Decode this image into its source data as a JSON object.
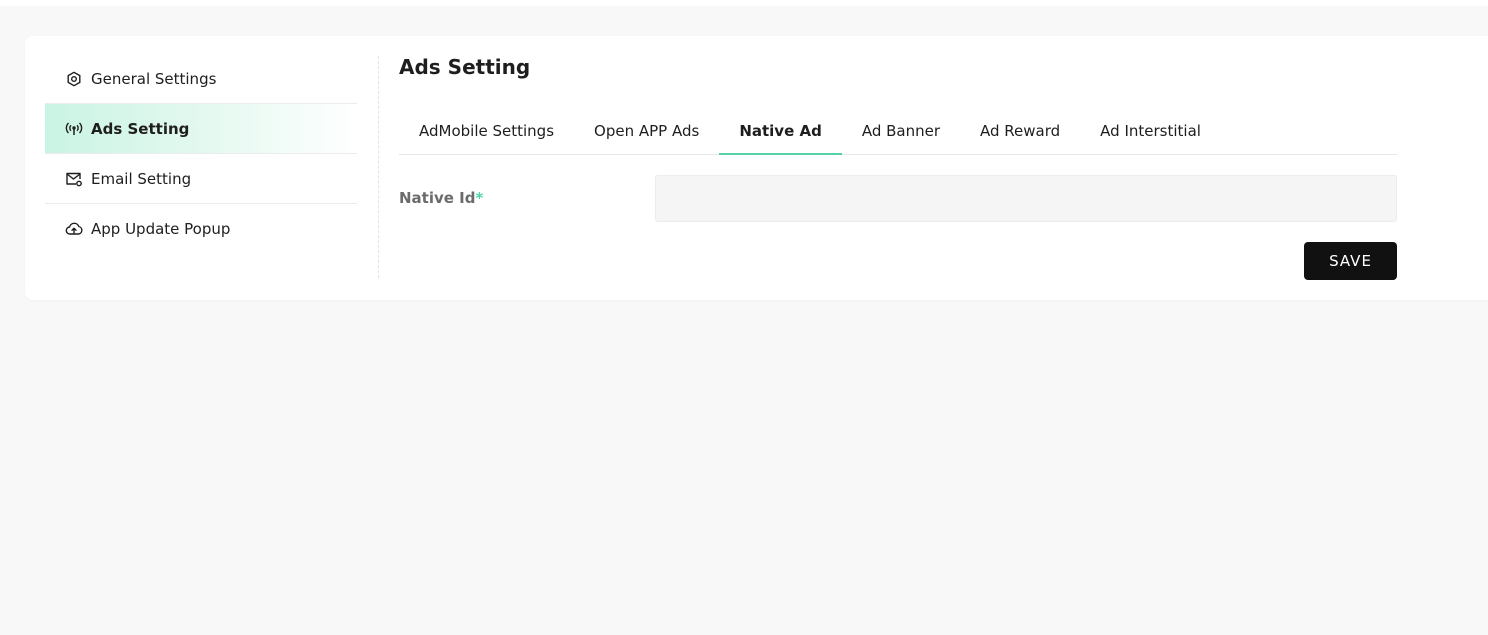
{
  "sidebar": {
    "items": [
      {
        "label": "General Settings",
        "icon": "gear-hex-icon"
      },
      {
        "label": "Ads Setting",
        "icon": "broadcast-icon"
      },
      {
        "label": "Email Setting",
        "icon": "mail-settings-icon"
      },
      {
        "label": "App Update Popup",
        "icon": "cloud-upload-icon"
      }
    ],
    "active_index": 1
  },
  "main": {
    "title": "Ads Setting",
    "tabs": [
      {
        "label": "AdMobile Settings"
      },
      {
        "label": "Open APP Ads"
      },
      {
        "label": "Native Ad"
      },
      {
        "label": "Ad Banner"
      },
      {
        "label": "Ad Reward"
      },
      {
        "label": "Ad Interstitial"
      }
    ],
    "active_tab_index": 2,
    "form": {
      "native_id_label": "Native Id",
      "required_mark": "*",
      "native_id_value": "",
      "save_label": "SAVE"
    }
  },
  "colors": {
    "accent": "#55d1a5",
    "active_bg": "#c9f4e3",
    "button_bg": "#111111",
    "page_bg": "#f8f8f8"
  }
}
